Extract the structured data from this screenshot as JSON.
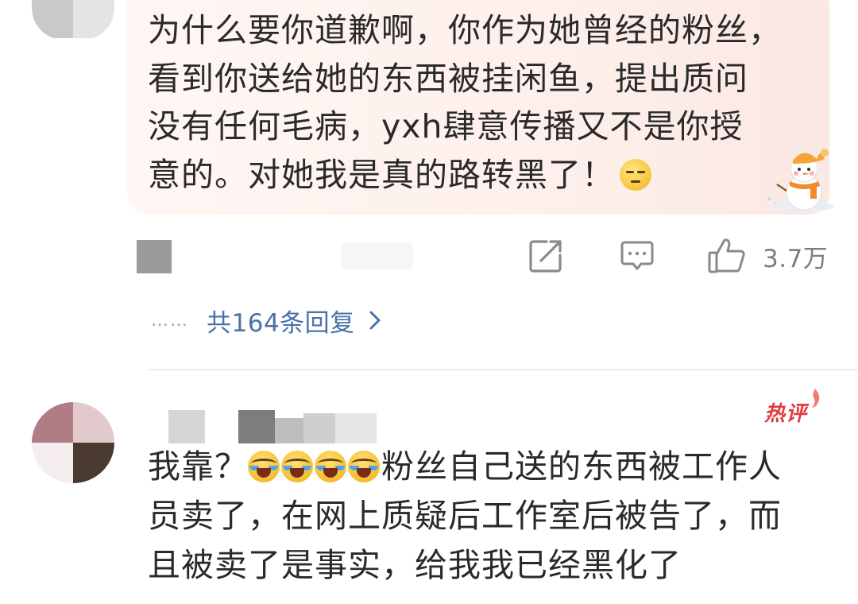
{
  "comment1": {
    "lines": [
      "为什么要你道歉啊，你作为她曾经的粉丝，",
      "看到你送给她的东西被挂闲鱼，提出质问",
      "没有任何毛病，yxh肆意传播又不是你授",
      "意的。对她我是真的路转黑了！"
    ],
    "emoji": "smirk-emoji",
    "decoration": "snowman-sticker",
    "actions": {
      "share_icon": "share-icon",
      "comment_icon": "comment-icon",
      "like_icon": "thumbs-up-icon",
      "like_count": "3.7万"
    },
    "replies": {
      "dots": "……",
      "label": "共164条回复",
      "icon": "chevron-right-icon"
    }
  },
  "comment2": {
    "badge": "热评",
    "text_before_emoji": "我靠？",
    "emojis": [
      "crying-laughing-emoji",
      "crying-laughing-emoji",
      "crying-laughing-emoji",
      "crying-laughing-emoji"
    ],
    "text_after_emoji": "粉丝自己送的东西被工作人",
    "lines": [
      "员卖了，在网上质疑后工作室后被告了，而",
      "且被卖了是事实，给我我已经黑化了"
    ]
  },
  "colors": {
    "bubble_bg": "#fdeeea",
    "link": "#4a72a8",
    "hot_badge": "#e23c3c",
    "icon_gray": "#8a8a8a"
  }
}
